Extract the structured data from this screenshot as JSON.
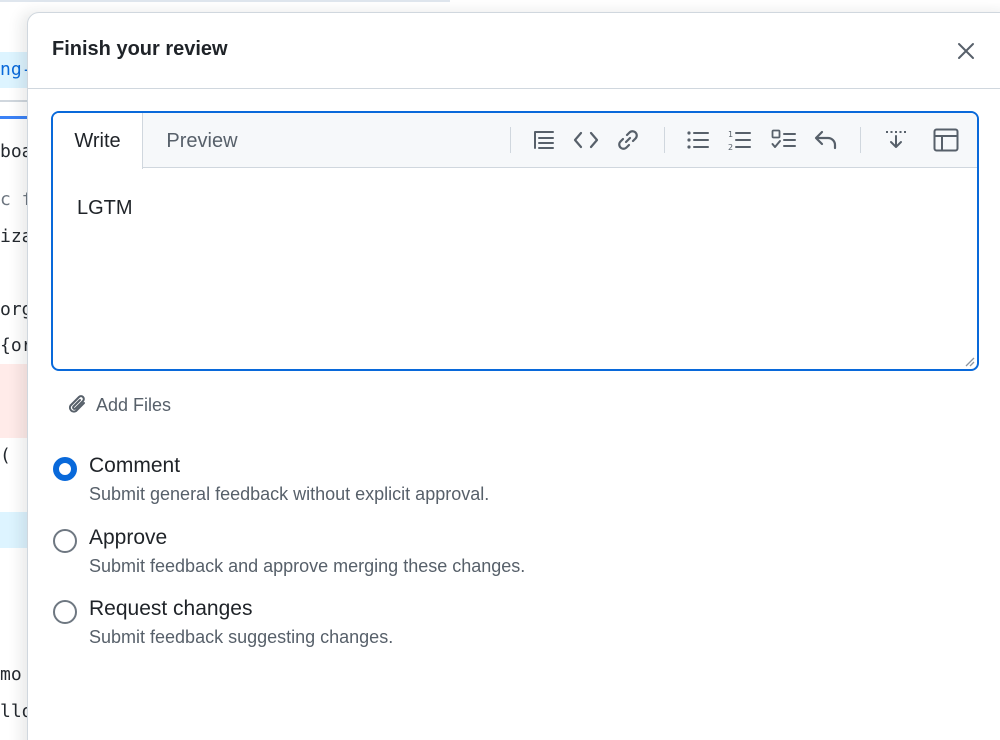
{
  "background": {
    "code_fragments": [
      "ng-",
      "boa",
      "c f",
      "iza",
      "org",
      "{or",
      "(",
      "mo",
      "llo"
    ]
  },
  "dialog": {
    "title": "Finish your review",
    "close_icon": "close-icon"
  },
  "editor": {
    "tabs": [
      {
        "label": "Write",
        "selected": true
      },
      {
        "label": "Preview",
        "selected": false
      }
    ],
    "toolbar_icons": [
      "heading-icon",
      "code-icon",
      "link-icon",
      "unordered-list-icon",
      "ordered-list-icon",
      "task-list-icon",
      "reply-icon",
      "insert-below-icon",
      "table-icon"
    ],
    "value": "LGTM"
  },
  "attachments": {
    "label": "Add Files",
    "icon": "paperclip-icon"
  },
  "review_options": [
    {
      "title": "Comment",
      "description": "Submit general feedback without explicit approval.",
      "checked": true
    },
    {
      "title": "Approve",
      "description": "Submit feedback and approve merging these changes.",
      "checked": false
    },
    {
      "title": "Request changes",
      "description": "Submit feedback suggesting changes.",
      "checked": false
    }
  ],
  "colors": {
    "accent": "#0969da",
    "text": "#1f2328",
    "muted_text": "#57606a",
    "border": "#d0d7de"
  }
}
